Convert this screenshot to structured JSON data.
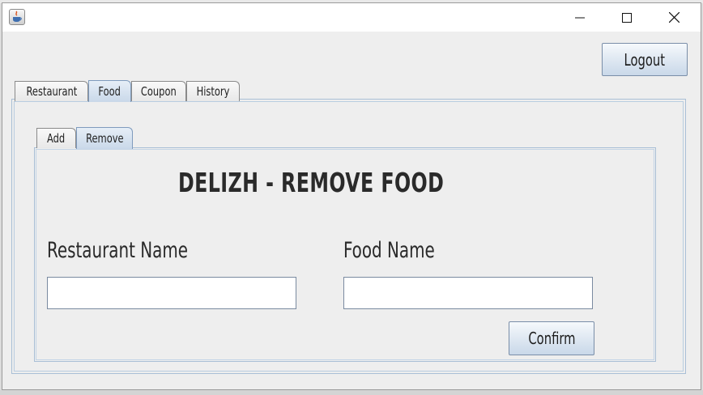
{
  "window": {
    "title": ""
  },
  "header": {
    "logout_label": "Logout"
  },
  "main_tabs": [
    {
      "label": "Restaurant"
    },
    {
      "label": "Food"
    },
    {
      "label": "Coupon"
    },
    {
      "label": "History"
    }
  ],
  "sub_tabs": [
    {
      "label": "Add"
    },
    {
      "label": "Remove"
    }
  ],
  "form": {
    "heading": "DELIZH - REMOVE FOOD",
    "restaurant_label": "Restaurant Name",
    "restaurant_value": "",
    "food_label": "Food Name",
    "food_value": "",
    "confirm_label": "Confirm"
  },
  "colors": {
    "active_tab": "#c9d8e9",
    "border_accent": "#a9bfd6",
    "background": "#eeeeee"
  }
}
